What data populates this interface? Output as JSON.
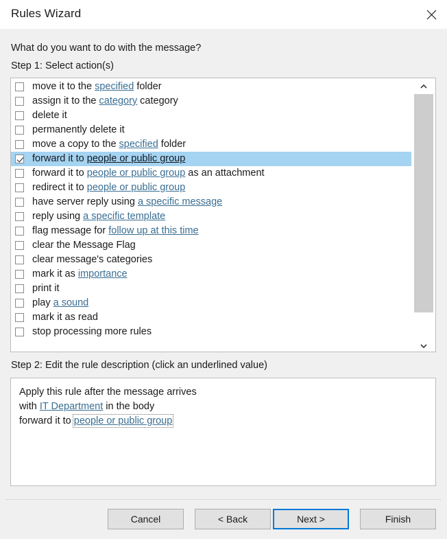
{
  "window": {
    "title": "Rules Wizard",
    "close_icon": "close-icon"
  },
  "main": {
    "prompt": "What do you want to do with the message?",
    "step1_label": "Step 1: Select action(s)",
    "step2_label": "Step 2: Edit the rule description (click an underlined value)"
  },
  "actions": [
    {
      "checked": false,
      "selected": false,
      "parts": [
        {
          "t": "move it to the ",
          "link": false
        },
        {
          "t": "specified",
          "link": true
        },
        {
          "t": " folder",
          "link": false
        }
      ]
    },
    {
      "checked": false,
      "selected": false,
      "parts": [
        {
          "t": "assign it to the ",
          "link": false
        },
        {
          "t": "category",
          "link": true
        },
        {
          "t": " category",
          "link": false
        }
      ]
    },
    {
      "checked": false,
      "selected": false,
      "parts": [
        {
          "t": "delete it",
          "link": false
        }
      ]
    },
    {
      "checked": false,
      "selected": false,
      "parts": [
        {
          "t": "permanently delete it",
          "link": false
        }
      ]
    },
    {
      "checked": false,
      "selected": false,
      "parts": [
        {
          "t": "move a copy to the ",
          "link": false
        },
        {
          "t": "specified",
          "link": true
        },
        {
          "t": " folder",
          "link": false
        }
      ]
    },
    {
      "checked": true,
      "selected": true,
      "parts": [
        {
          "t": "forward it to ",
          "link": false
        },
        {
          "t": "people or public group",
          "link": true
        }
      ]
    },
    {
      "checked": false,
      "selected": false,
      "parts": [
        {
          "t": "forward it to ",
          "link": false
        },
        {
          "t": "people or public group",
          "link": true
        },
        {
          "t": " as an attachment",
          "link": false
        }
      ]
    },
    {
      "checked": false,
      "selected": false,
      "parts": [
        {
          "t": "redirect it to ",
          "link": false
        },
        {
          "t": "people or public group",
          "link": true
        }
      ]
    },
    {
      "checked": false,
      "selected": false,
      "parts": [
        {
          "t": "have server reply using ",
          "link": false
        },
        {
          "t": "a specific message",
          "link": true
        }
      ]
    },
    {
      "checked": false,
      "selected": false,
      "parts": [
        {
          "t": "reply using ",
          "link": false
        },
        {
          "t": "a specific template",
          "link": true
        }
      ]
    },
    {
      "checked": false,
      "selected": false,
      "parts": [
        {
          "t": "flag message for ",
          "link": false
        },
        {
          "t": "follow up at this time",
          "link": true
        }
      ]
    },
    {
      "checked": false,
      "selected": false,
      "parts": [
        {
          "t": "clear the Message Flag",
          "link": false
        }
      ]
    },
    {
      "checked": false,
      "selected": false,
      "parts": [
        {
          "t": "clear message's categories",
          "link": false
        }
      ]
    },
    {
      "checked": false,
      "selected": false,
      "parts": [
        {
          "t": "mark it as ",
          "link": false
        },
        {
          "t": "importance",
          "link": true
        }
      ]
    },
    {
      "checked": false,
      "selected": false,
      "parts": [
        {
          "t": "print it",
          "link": false
        }
      ]
    },
    {
      "checked": false,
      "selected": false,
      "parts": [
        {
          "t": "play ",
          "link": false
        },
        {
          "t": "a sound",
          "link": true
        }
      ]
    },
    {
      "checked": false,
      "selected": false,
      "parts": [
        {
          "t": "mark it as read",
          "link": false
        }
      ]
    },
    {
      "checked": false,
      "selected": false,
      "parts": [
        {
          "t": "stop processing more rules",
          "link": false
        }
      ]
    }
  ],
  "description_lines": [
    [
      {
        "t": "Apply this rule after the message arrives",
        "link": false
      }
    ],
    [
      {
        "t": "with ",
        "link": false
      },
      {
        "t": "IT Department",
        "link": true
      },
      {
        "t": " in the body",
        "link": false
      }
    ],
    [
      {
        "t": "forward it to ",
        "link": false
      },
      {
        "t": "people or public group",
        "link": true,
        "focused": true
      }
    ]
  ],
  "scrollbar": {
    "up_icon": "chevron-up-icon",
    "down_icon": "chevron-down-icon"
  },
  "buttons": {
    "cancel": "Cancel",
    "back": "< Back",
    "next": "Next >",
    "finish": "Finish"
  },
  "colors": {
    "selection": "#a5d3f2",
    "link": "#3a6e92",
    "focus_border": "#0078d7",
    "dialog_bg": "#f0f0f0",
    "field_bg": "#ffffff"
  }
}
